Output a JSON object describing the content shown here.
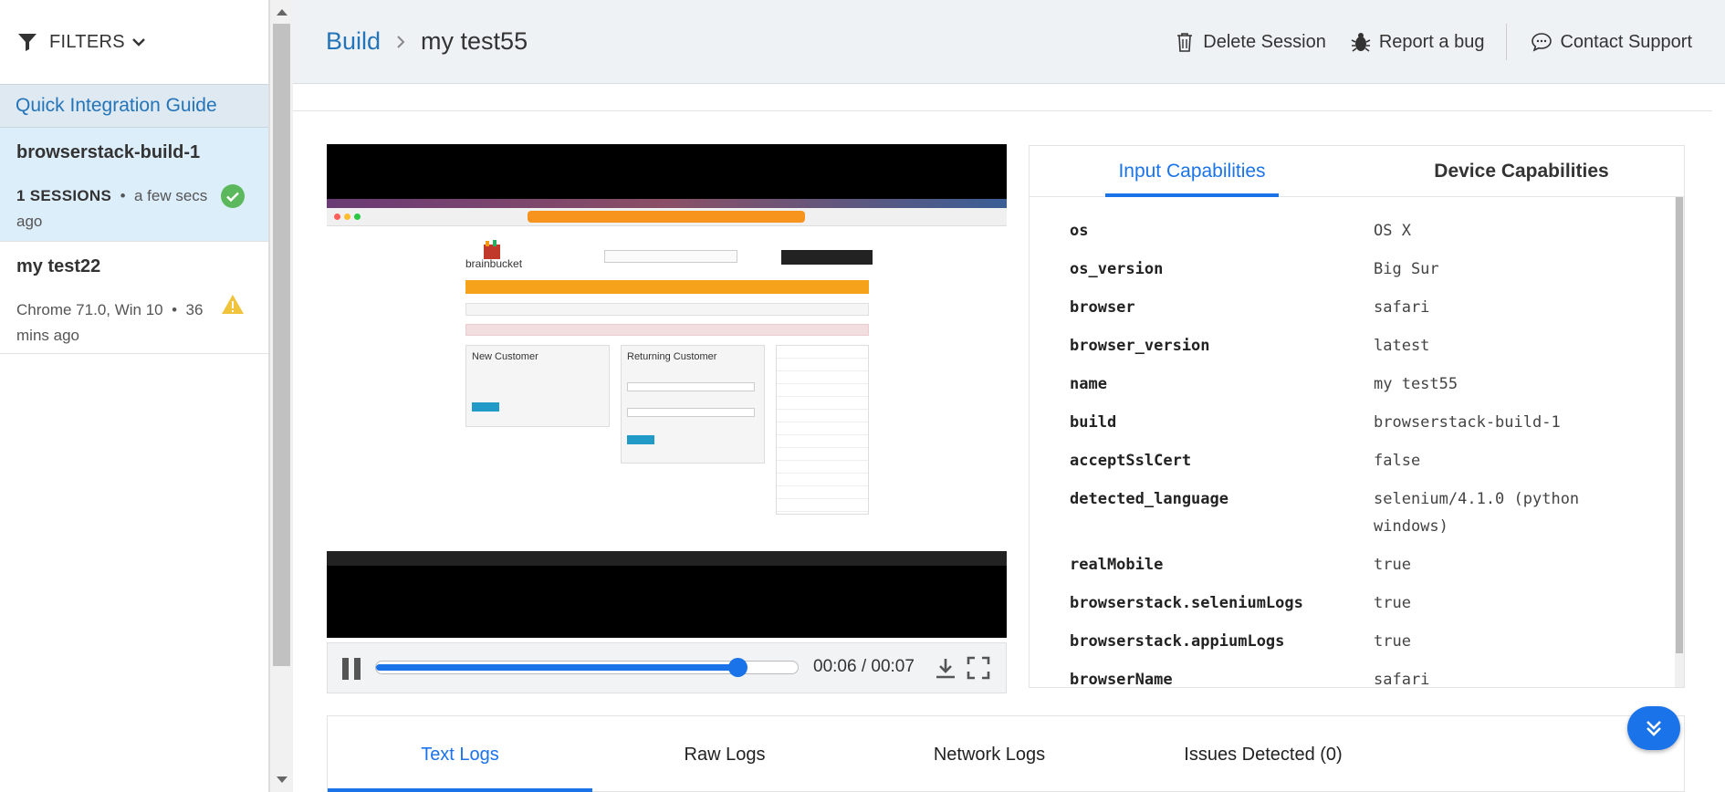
{
  "sidebar": {
    "filters_label": "FILTERS",
    "guide_label": "Quick Integration Guide",
    "sessions": [
      {
        "name": "browserstack-build-1",
        "count": "1 SESSIONS",
        "sep": "•",
        "time": "a few secs ago",
        "status": "passed"
      },
      {
        "name": "my test22",
        "env": "Chrome 71.0, Win 10",
        "sep": "•",
        "time": "36 mins ago",
        "status": "warning"
      }
    ]
  },
  "header": {
    "breadcrumb_root": "Build",
    "breadcrumb_current": "my test55",
    "delete_label": "Delete Session",
    "bug_label": "Report a bug",
    "support_label": "Contact Support"
  },
  "video": {
    "time_display": "00:06 / 00:07",
    "progress": 0.857,
    "logo_text": "brainbucket",
    "box1_title": "New Customer",
    "box2_title": "Returning Customer"
  },
  "capabilities": {
    "tabs": [
      "Input Capabilities",
      "Device Capabilities"
    ],
    "active_tab": "Input Capabilities",
    "rows": [
      {
        "key": "os",
        "value": "OS X"
      },
      {
        "key": "os_version",
        "value": "Big Sur"
      },
      {
        "key": "browser",
        "value": "safari"
      },
      {
        "key": "browser_version",
        "value": "latest"
      },
      {
        "key": "name",
        "value": "my test55"
      },
      {
        "key": "build",
        "value": "browserstack-build-1"
      },
      {
        "key": "acceptSslCert",
        "value": "false"
      },
      {
        "key": "detected_language",
        "value": "selenium/4.1.0 (python windows)"
      },
      {
        "key": "realMobile",
        "value": "true"
      },
      {
        "key": "browserstack.seleniumLogs",
        "value": "true"
      },
      {
        "key": "browserstack.appiumLogs",
        "value": "true"
      },
      {
        "key": "browserName",
        "value": "safari"
      }
    ]
  },
  "logs": {
    "tabs": [
      "Text Logs",
      "Raw Logs",
      "Network Logs",
      "Issues Detected (0)"
    ],
    "active_tab": "Text Logs"
  },
  "colors": {
    "accent": "#1a73e8",
    "link": "#2374b9",
    "pass": "#5cb85c",
    "warn": "#f0c33c"
  }
}
